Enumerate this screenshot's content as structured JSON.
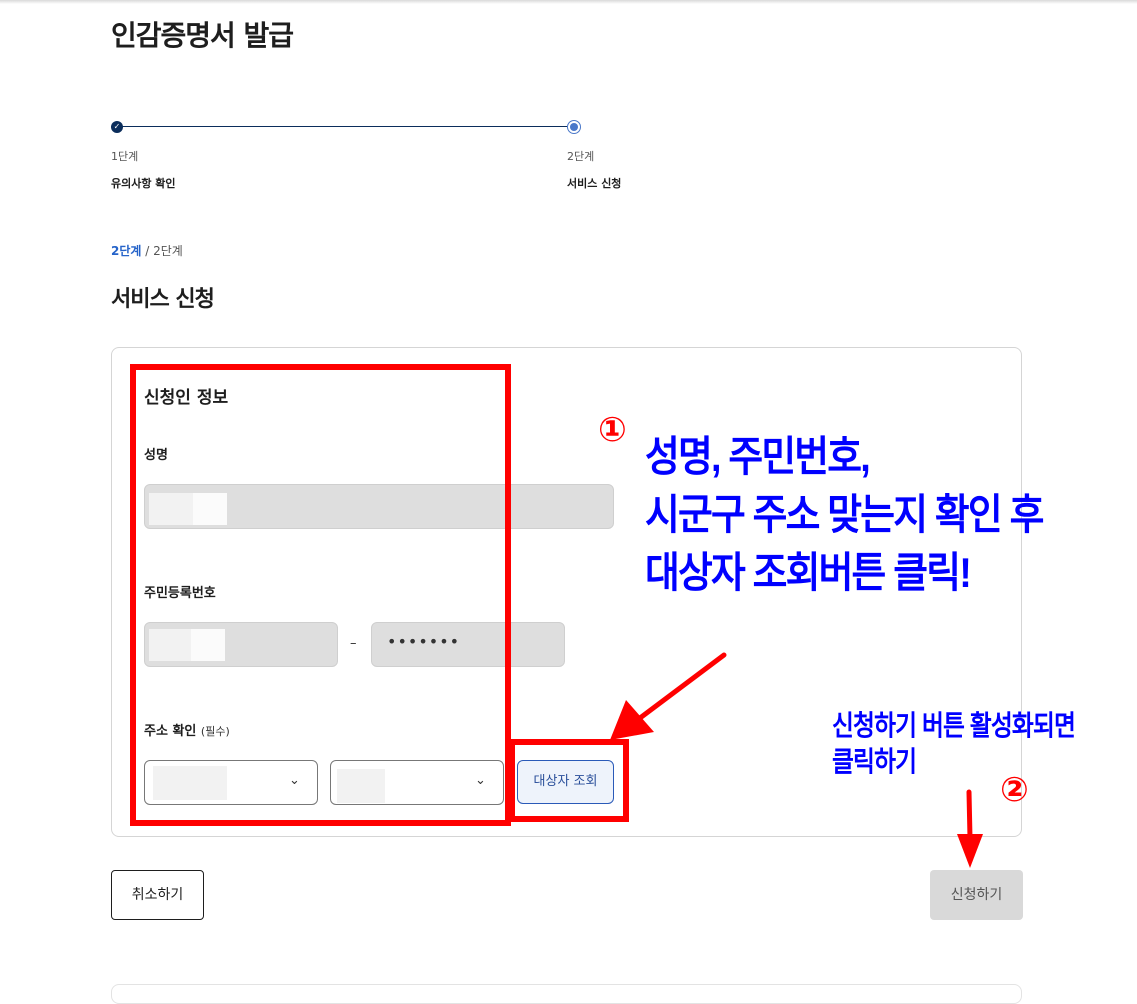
{
  "page": {
    "title": "인감증명서 발급"
  },
  "stepper": {
    "steps": [
      {
        "num": "1단계",
        "name": "유의사항 확인",
        "state": "done"
      },
      {
        "num": "2단계",
        "name": "서비스 신청",
        "state": "current"
      }
    ]
  },
  "breadcrumb": {
    "current": "2단계",
    "separator": " / ",
    "total": "2단계"
  },
  "section": {
    "title": "서비스 신청"
  },
  "applicant": {
    "title": "신청인 정보",
    "name_label": "성명",
    "rrn_label": "주민등록번호",
    "rrn_separator": "–",
    "rrn_back_value": "•••••••",
    "address_label": "주소 확인",
    "address_required": "(필수)",
    "lookup_button": "대상자 조회"
  },
  "actions": {
    "cancel": "취소하기",
    "apply": "신청하기",
    "apply_enabled": false
  },
  "annotations": {
    "step1_marker": "①",
    "step1_lines": [
      "성명, 주민번호,",
      "시군구 주소 맞는지 확인 후",
      "대상자 조회버튼 클릭!"
    ],
    "step2_marker": "②",
    "step2_lines": [
      "신청하기 버튼 활성화되면",
      "클릭하기"
    ],
    "highlight_color": "#ff0000",
    "note_color": "#0000ff"
  },
  "colors": {
    "primary": "#0b2d5b",
    "accent": "#2563c9",
    "input_bg": "#dedede",
    "disabled_button": "#d9d9d9"
  }
}
